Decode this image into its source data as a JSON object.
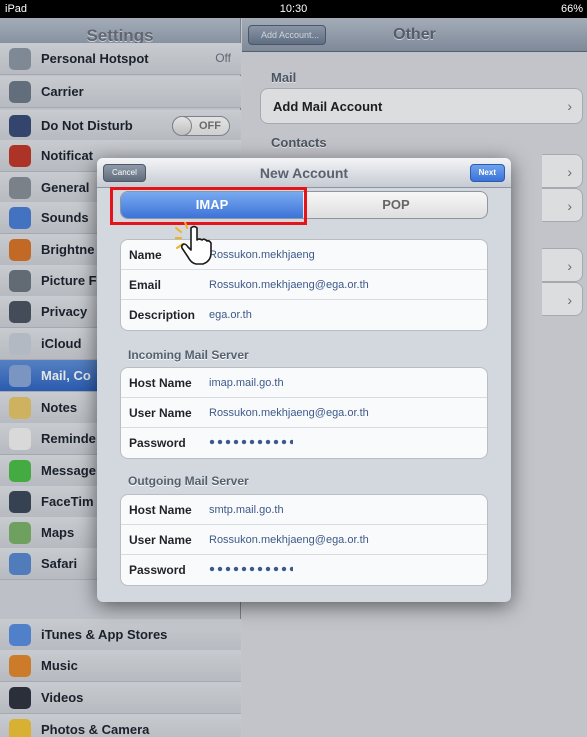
{
  "status_bar": {
    "device": "iPad",
    "time": "10:30",
    "battery": "66%"
  },
  "settings_pane": {
    "title": "Settings",
    "items": [
      {
        "label": "Personal Hotspot",
        "value": "Off",
        "icon": "hotspot-icon",
        "color": "#8e98a6"
      },
      {
        "label": "Carrier",
        "icon": "carrier-icon",
        "color": "#6f7b8c"
      },
      {
        "label": "Do Not Disturb",
        "toggle": "OFF",
        "icon": "moon-icon",
        "color": "#3a4d7a"
      },
      {
        "label": "Notificat",
        "icon": "notifications-icon",
        "color": "#c0392b"
      },
      {
        "label": "General",
        "icon": "gear-icon",
        "color": "#8a9099"
      },
      {
        "label": "Sounds",
        "icon": "speaker-icon",
        "color": "#4a7fd6"
      },
      {
        "label": "Brightne",
        "icon": "brightness-icon",
        "color": "#d9752b"
      },
      {
        "label": "Picture F",
        "icon": "picture-frame-icon",
        "color": "#6e7680"
      },
      {
        "label": "Privacy",
        "icon": "hand-icon",
        "color": "#4b5563"
      },
      {
        "label": "iCloud",
        "icon": "cloud-icon",
        "color": "#c8ced8"
      },
      {
        "label": "Mail, Co",
        "icon": "mail-icon",
        "color": "#8aa6d8"
      },
      {
        "label": "Notes",
        "icon": "notes-icon",
        "color": "#e7c76a"
      },
      {
        "label": "Reminde",
        "icon": "reminders-icon",
        "color": "#f2f2f2"
      },
      {
        "label": "Message",
        "icon": "messages-icon",
        "color": "#4bbf4a"
      },
      {
        "label": "FaceTim",
        "icon": "facetime-icon",
        "color": "#3d4a5c"
      },
      {
        "label": "Maps",
        "icon": "maps-icon",
        "color": "#7bb36a"
      },
      {
        "label": "Safari",
        "icon": "compass-icon",
        "color": "#5b8bd1"
      },
      {
        "label": "iTunes & App Stores",
        "icon": "app-store-icon",
        "color": "#5a8fe0"
      },
      {
        "label": "Music",
        "icon": "music-icon",
        "color": "#e28a2f"
      },
      {
        "label": "Videos",
        "icon": "video-icon",
        "color": "#2f3540"
      },
      {
        "label": "Photos & Camera",
        "icon": "flower-icon",
        "color": "#f0c43a"
      }
    ]
  },
  "detail_pane": {
    "back_label": "Add Account...",
    "title": "Other",
    "mail_section": "Mail",
    "add_mail_account": "Add Mail Account",
    "contacts_section": "Contacts"
  },
  "modal": {
    "title": "New Account",
    "cancel_label": "Cancel",
    "next_label": "Next",
    "segments": {
      "imap": "IMAP",
      "pop": "POP"
    },
    "account": {
      "name_label": "Name",
      "name_value": "Rossukon.mekhjaeng",
      "email_label": "Email",
      "email_value": "Rossukon.mekhjaeng@ega.or.th",
      "description_label": "Description",
      "description_value": "ega.or.th"
    },
    "incoming": {
      "header": "Incoming Mail Server",
      "host_label": "Host Name",
      "host_value": "imap.mail.go.th",
      "user_label": "User Name",
      "user_value": "Rossukon.mekhjaeng@ega.or.th",
      "password_label": "Password"
    },
    "outgoing": {
      "header": "Outgoing Mail Server",
      "host_label": "Host Name",
      "host_value": "smtp.mail.go.th",
      "user_label": "User Name",
      "user_value": "Rossukon.mekhjaeng@ega.or.th",
      "password_label": "Password"
    }
  }
}
